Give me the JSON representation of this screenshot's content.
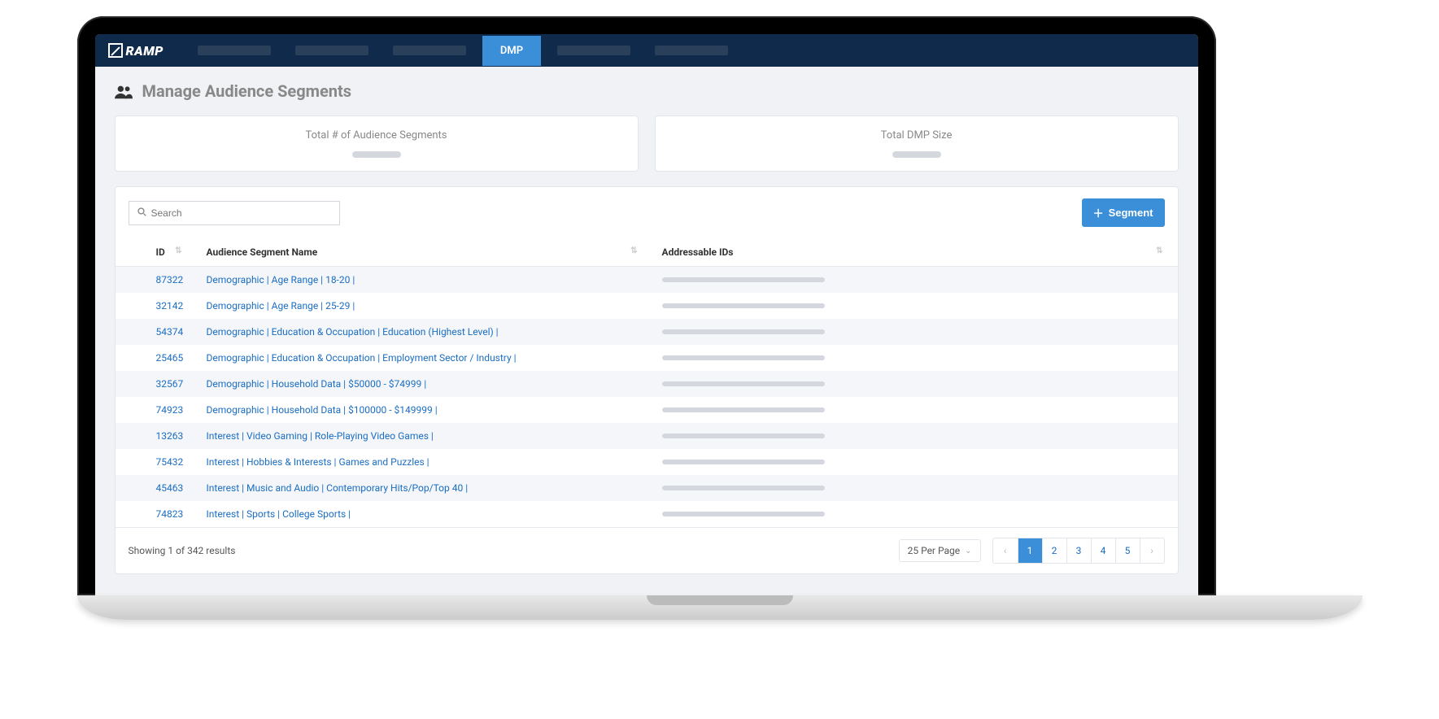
{
  "brand": "RAMP",
  "nav": {
    "active": "DMP"
  },
  "page": {
    "title": "Manage Audience Segments"
  },
  "stats": [
    {
      "label": "Total # of Audience Segments"
    },
    {
      "label": "Total DMP Size"
    }
  ],
  "toolbar": {
    "search_placeholder": "Search",
    "add_label": "Segment"
  },
  "columns": {
    "id": "ID",
    "name": "Audience Segment Name",
    "addr": "Addressable IDs"
  },
  "rows": [
    {
      "id": "87322",
      "name": "Demographic | Age Range |  18-20 |"
    },
    {
      "id": "32142",
      "name": "Demographic | Age Range |  25-29 |"
    },
    {
      "id": "54374",
      "name": "Demographic | Education & Occupation |  Education (Highest Level) |"
    },
    {
      "id": "25465",
      "name": "Demographic | Education & Occupation |  Employment Sector / Industry |"
    },
    {
      "id": "32567",
      "name": "Demographic | Household Data |  $50000 - $74999 |"
    },
    {
      "id": "74923",
      "name": "Demographic | Household Data |  $100000 - $149999 |"
    },
    {
      "id": "13263",
      "name": "Interest | Video Gaming |  Role-Playing Video Games |"
    },
    {
      "id": "75432",
      "name": "Interest | Hobbies & Interests |  Games and Puzzles |"
    },
    {
      "id": "45463",
      "name": "Interest | Music and Audio |  Contemporary Hits/Pop/Top 40 |"
    },
    {
      "id": "74823",
      "name": "Interest | Sports |  College Sports |"
    }
  ],
  "footer": {
    "summary": "Showing 1 of 342 results",
    "per_page": "25 Per Page",
    "pages": [
      "1",
      "2",
      "3",
      "4",
      "5"
    ],
    "active_page": "1"
  }
}
